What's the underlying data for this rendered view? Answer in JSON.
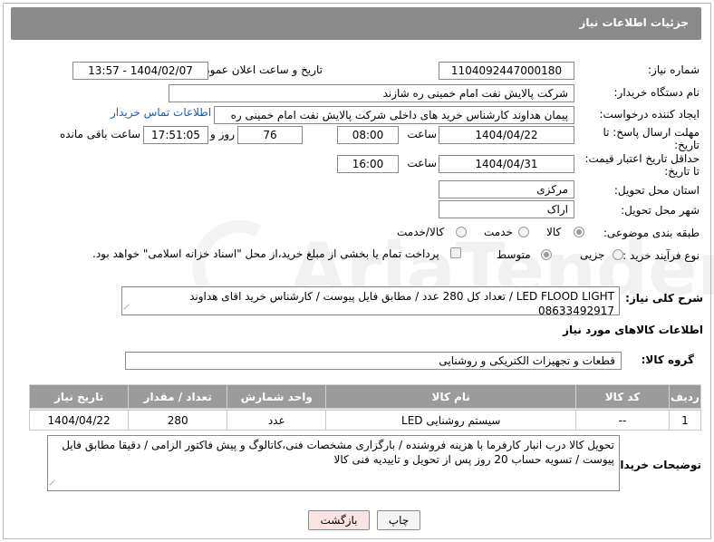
{
  "header": {
    "title": "جزئیات اطلاعات نیاز"
  },
  "fields": {
    "need_number_label": "شماره نیاز:",
    "need_number": "1104092447000180",
    "announce_label": "تاریخ و ساعت اعلان عمومی:",
    "announce_value": "1404/02/07 - 13:57",
    "buyer_org_label": "نام دستگاه خریدار:",
    "buyer_org": "شرکت پالایش نفت امام خمینی  ره  شازند",
    "creator_label": "ایجاد کننده درخواست:",
    "creator": "پیمان هداوند کارشناس خرید های داخلی  شرکت پالایش نفت امام خمینی  ره",
    "contact_link": "اطلاعات تماس خریدار",
    "deadline_label_1": "مهلت ارسال پاسخ: تا",
    "deadline_label_2": "تاریخ:",
    "deadline_date": "1404/04/22",
    "time_label": "ساعت",
    "deadline_time": "08:00",
    "days_value": "76",
    "days_label": "روز و",
    "remaining_time": "17:51:05",
    "remaining_label": "ساعت باقی مانده",
    "min_validity_label_1": "حداقل تاریخ اعتبار قیمت:",
    "min_validity_label_2": "تا تاریخ:",
    "validity_date": "1404/04/31",
    "validity_time": "16:00",
    "province_label": "استان محل تحویل:",
    "province": "مرکزی",
    "city_label": "شهر محل تحویل:",
    "city": "اراک",
    "category_label": "طبقه بندی موضوعی:",
    "category_options": [
      "کالا",
      "خدمت",
      "کالا/خدمت"
    ],
    "process_label": "نوع فرآیند خرید :",
    "process_options": [
      "جزیی",
      "متوسط"
    ],
    "payment_note": "پرداخت تمام یا بخشی از مبلغ خرید،از محل \"اسناد خزانه اسلامی\" خواهد بود.",
    "description_label": "شرح کلی نیاز:",
    "description": "LED FLOOD LIGHT / تعداد کل 280 عدد / مطابق فایل پیوست / کارشناس خرید اقای هداوند 08633492917",
    "goods_info_title": "اطلاعات کالاهای مورد نیاز",
    "goods_group_label": "گروه کالا:",
    "goods_group": "قطعات و تجهیزات الکتریکی و روشنایی",
    "buyer_notes_label": "توضیحات خریدار:",
    "buyer_notes": "تحویل کالا درب انبار کارفرما با هزینه فروشنده / بارگزاری مشخصات فنی،کاتالوگ و پیش فاکتور الزامی / دقیقا مطابق فایل پیوست / تسویه حساب 20 روز پس از تحویل و تاییدیه فنی کالا"
  },
  "table": {
    "headers": [
      "ردیف",
      "کد کالا",
      "نام کالا",
      "واحد شمارش",
      "تعداد / مقدار",
      "تاریخ نیاز"
    ],
    "rows": [
      [
        "1",
        "--",
        "سیستم روشنایی LED",
        "عدد",
        "280",
        "1404/04/22"
      ]
    ]
  },
  "buttons": {
    "print": "چاپ",
    "back": "بازگشت"
  },
  "watermark": {
    "text": "AriaTender.neT"
  },
  "colors": {
    "header_bg": "#8a8a8a",
    "link": "#1a5fa8",
    "back_button_bg": "#fbe3e3"
  }
}
